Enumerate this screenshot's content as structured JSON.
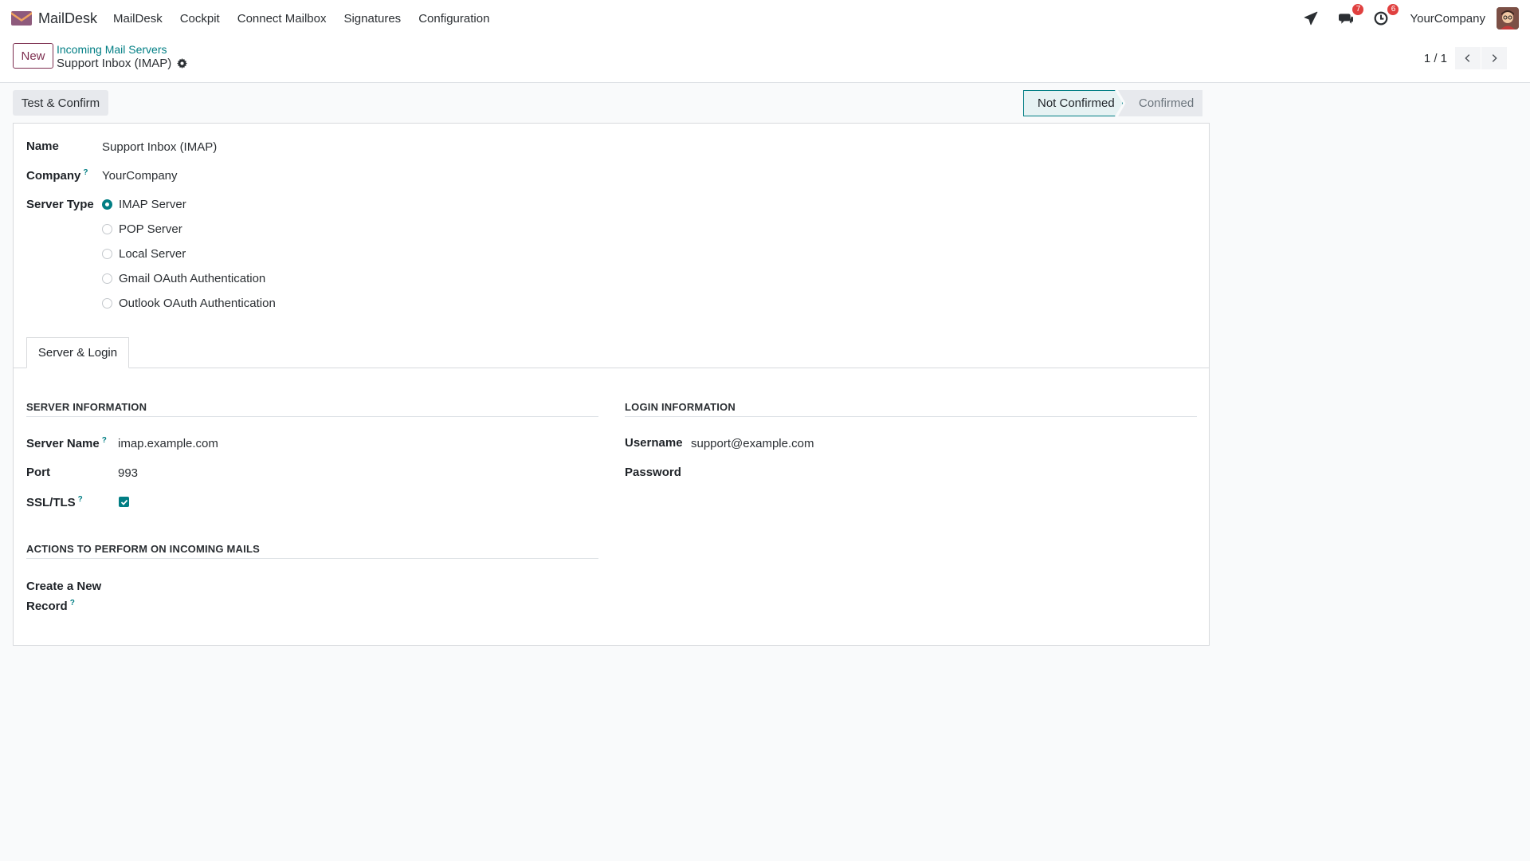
{
  "navbar": {
    "brand": "MailDesk",
    "menu": [
      "MailDesk",
      "Cockpit",
      "Connect Mailbox",
      "Signatures",
      "Configuration"
    ],
    "messages_count": "7",
    "activities_count": "6",
    "company": "YourCompany"
  },
  "control_panel": {
    "new_label": "New",
    "breadcrumb_parent": "Incoming Mail Servers",
    "breadcrumb_current": "Support Inbox (IMAP)",
    "pager": "1 / 1"
  },
  "statusbar": {
    "test_button": "Test & Confirm",
    "stages": [
      "Not Confirmed",
      "Confirmed"
    ],
    "active_stage": "Not Confirmed"
  },
  "form": {
    "name_label": "Name",
    "name_value": "Support Inbox (IMAP)",
    "company_label": "Company",
    "company_value": "YourCompany",
    "server_type_label": "Server Type",
    "server_types": [
      "IMAP Server",
      "POP Server",
      "Local Server",
      "Gmail OAuth Authentication",
      "Outlook OAuth Authentication"
    ],
    "selected_server_type": "IMAP Server",
    "help_mark": "?"
  },
  "tabs": {
    "server_login": "Server & Login"
  },
  "server_info": {
    "title": "SERVER INFORMATION",
    "server_name_label": "Server Name",
    "server_name_value": "imap.example.com",
    "port_label": "Port",
    "port_value": "993",
    "ssl_label": "SSL/TLS",
    "ssl_checked": true
  },
  "login_info": {
    "title": "LOGIN INFORMATION",
    "username_label": "Username",
    "username_value": "support@example.com",
    "password_label": "Password"
  },
  "actions": {
    "title": "ACTIONS TO PERFORM ON INCOMING MAILS",
    "create_record_label_line1": "Create a New",
    "create_record_label_line2": "Record"
  },
  "colors": {
    "accent": "#017e84",
    "brand": "#7d2e4f",
    "badge": "#e0403f"
  }
}
